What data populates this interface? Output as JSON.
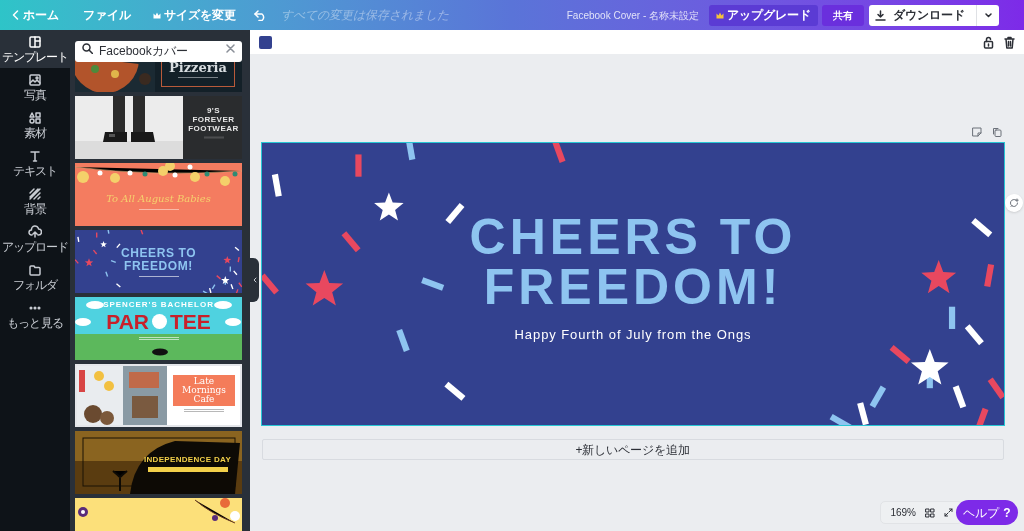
{
  "topbar": {
    "home": "ホーム",
    "file": "ファイル",
    "resize": "サイズを変更",
    "save_status": "すべての変更は保存されました",
    "doc_title": "Facebook Cover - 名称未設定",
    "upgrade": "アップグレード",
    "share": "共有",
    "download": "ダウンロード"
  },
  "rail": [
    {
      "kind": "templates",
      "label": "テンプレート",
      "selected": true
    },
    {
      "kind": "photos",
      "label": "写真",
      "selected": false
    },
    {
      "kind": "elements",
      "label": "素材",
      "selected": false
    },
    {
      "kind": "text",
      "label": "テキスト",
      "selected": false
    },
    {
      "kind": "background",
      "label": "背景",
      "selected": false
    },
    {
      "kind": "upload",
      "label": "アップロード",
      "selected": false
    },
    {
      "kind": "folder",
      "label": "フォルダ",
      "selected": false
    },
    {
      "kind": "more",
      "label": "もっと見る",
      "selected": false
    }
  ],
  "search": {
    "value": "Facebookカバー"
  },
  "templates": [
    {
      "kind": "pizzeria",
      "lines": [
        "Pizzeria"
      ]
    },
    {
      "kind": "footwear",
      "lines": [
        "9'S",
        "FOREVER",
        "FOOTWEAR"
      ]
    },
    {
      "kind": "birthday",
      "lines": [
        "To All August Babies"
      ]
    },
    {
      "kind": "cheers",
      "lines": [
        "CHEERS TO",
        "FREEDOM!"
      ]
    },
    {
      "kind": "partee",
      "lines": [
        "SPENCER'S BACHELOR",
        "PAR",
        "TEE"
      ]
    },
    {
      "kind": "cafe",
      "lines": [
        "Late",
        "Mornings",
        "Cafe"
      ]
    },
    {
      "kind": "independence",
      "lines": [
        "INDEPENDENCE DAY"
      ]
    },
    {
      "kind": "floral"
    }
  ],
  "design": {
    "title_lines": [
      "CHEERS TO",
      "FREEDOM!"
    ],
    "subtitle": "Happy Fourth of July from the Ongs"
  },
  "add_page": "+新しいページを追加",
  "zoom": "169%",
  "help": {
    "label": "ヘルプ",
    "icon": "?"
  }
}
